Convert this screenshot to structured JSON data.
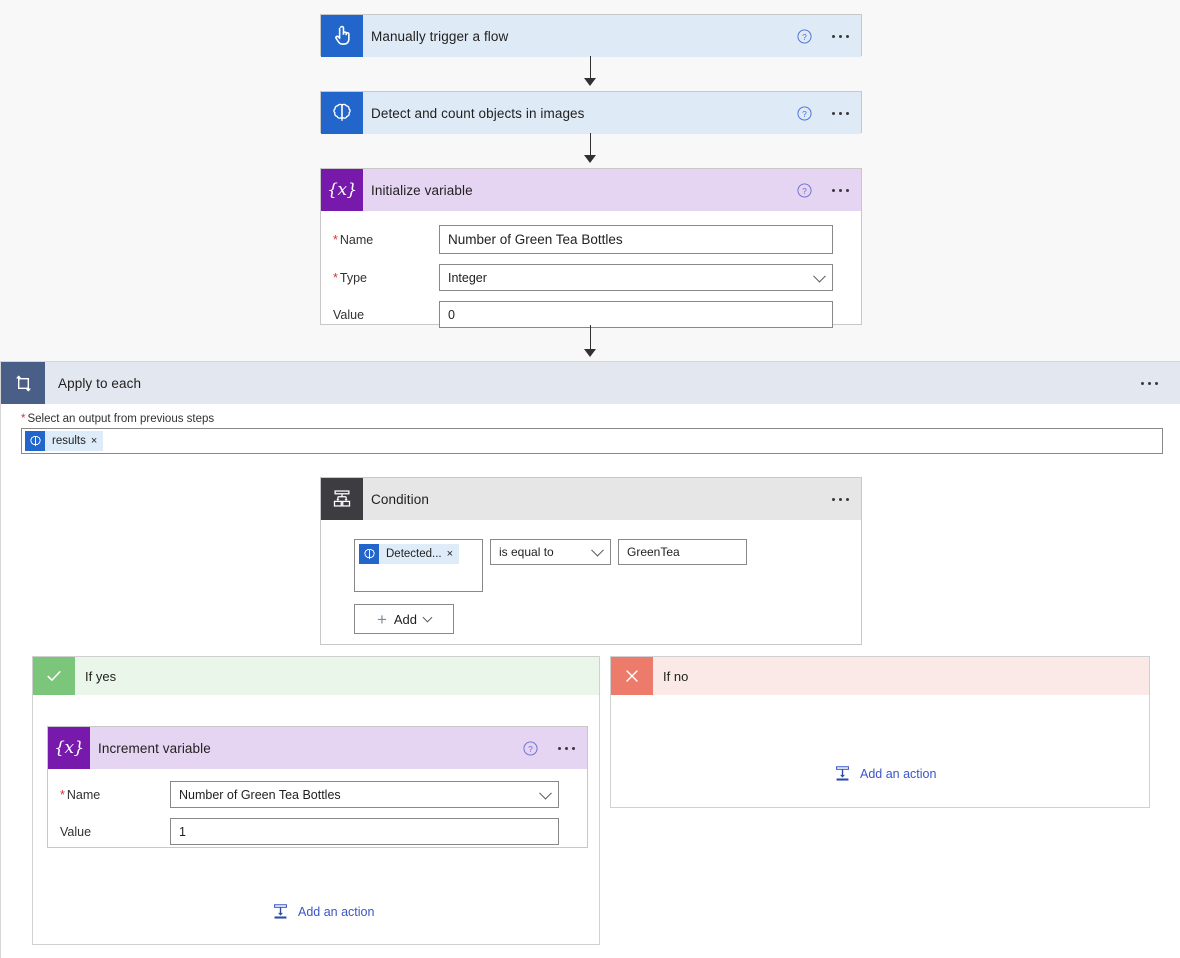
{
  "flow": {
    "trigger": {
      "title": "Manually trigger a flow",
      "icon": "manual-trigger-icon",
      "help": "help-icon",
      "more": "more-options-icon"
    },
    "detect_action": {
      "title": "Detect and count objects in images",
      "icon": "ai-builder-brain-icon",
      "help": "help-icon",
      "more": "more-options-icon"
    },
    "initialize_variable": {
      "title": "Initialize variable",
      "icon": "variable-icon",
      "icon_glyph": "{x}",
      "fields": [
        {
          "label": "Name",
          "required": true,
          "value": "Number of Green Tea Bottles",
          "type": "text"
        },
        {
          "label": "Type",
          "required": true,
          "value": "Integer",
          "type": "select"
        },
        {
          "label": "Value",
          "required": false,
          "value": "0",
          "type": "text"
        }
      ]
    },
    "apply_to_each": {
      "title": "Apply to each",
      "icon": "loop-icon",
      "more": "more-options-icon",
      "select_output_label": "Select an output from previous steps",
      "select_output_required": true,
      "token": {
        "text": "results",
        "icon": "ai-builder-brain-icon",
        "remove": "×"
      }
    },
    "condition": {
      "title": "Condition",
      "icon": "condition-icon",
      "more": "more-options-icon",
      "left_operand": {
        "text": "Detected...",
        "icon": "ai-builder-brain-icon",
        "remove": "×"
      },
      "operator": "is equal to",
      "right_operand": "GreenTea",
      "add_button": "Add"
    },
    "if_yes": {
      "label": "If yes",
      "icon": "check-icon",
      "action": {
        "title": "Increment variable",
        "icon": "variable-icon",
        "icon_glyph": "{x}",
        "fields": [
          {
            "label": "Name",
            "required": true,
            "value": "Number of Green Tea Bottles",
            "type": "select"
          },
          {
            "label": "Value",
            "required": false,
            "value": "1",
            "type": "text"
          }
        ]
      },
      "add_action_label": "Add an action"
    },
    "if_no": {
      "label": "If no",
      "icon": "close-icon",
      "add_action_label": "Add an action"
    }
  },
  "colors": {
    "trigger_header": "#dfeaf7",
    "trigger_icon": "#2266cc",
    "variable_header": "#e5d5f2",
    "variable_icon": "#7719aa",
    "condition_header": "#e6e6e6",
    "condition_icon": "#3c3c41",
    "loop_header": "#e3e7ef",
    "loop_icon": "#4a5f87",
    "yes_header": "#eaf6ea",
    "yes_icon": "#7bc67b",
    "no_header": "#fbe9e7",
    "no_icon": "#ec7b6c",
    "link": "#3a55c9",
    "required": "#d13438",
    "canvas": "#f8f8f8"
  }
}
